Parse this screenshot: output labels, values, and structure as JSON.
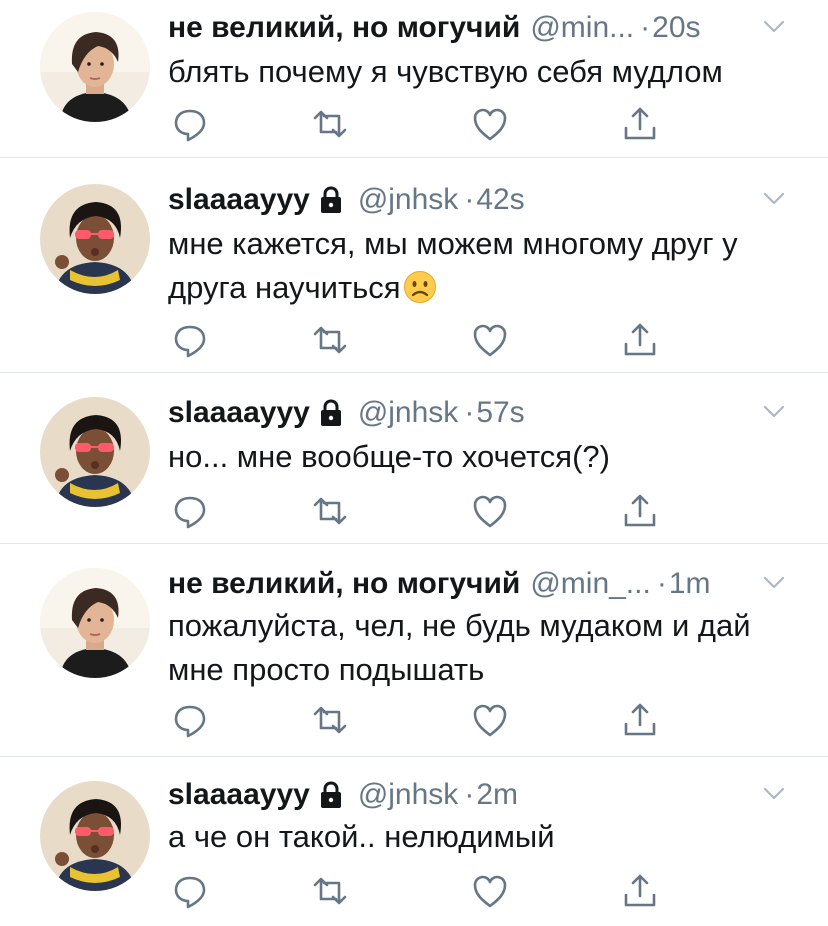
{
  "tweets": [
    {
      "name": "не великий, но могучий",
      "handle": "@min...",
      "separator": "·",
      "time": "20s",
      "locked": false,
      "text": "блять почему я чувствую себя мудлом",
      "avatar": "photo-person-1"
    },
    {
      "name": "slaaaayyy",
      "handle": "@jnhsk",
      "separator": "·",
      "time": "42s",
      "locked": true,
      "text": "мне кажется, мы можем многому друг у друга научиться",
      "emoji": "frowning-face",
      "avatar": "photo-person-2"
    },
    {
      "name": "slaaaayyy",
      "handle": "@jnhsk",
      "separator": "·",
      "time": "57s",
      "locked": true,
      "text": "но... мне вообще-то хочется(?)",
      "avatar": "photo-person-2"
    },
    {
      "name": "не великий, но могучий",
      "handle": "@min_...",
      "separator": "·",
      "time": "1m",
      "locked": false,
      "text": "пожалуйста, чел, не будь мудаком и дай мне просто подышать",
      "avatar": "photo-person-1"
    },
    {
      "name": "slaaaayyy",
      "handle": "@jnhsk",
      "separator": "·",
      "time": "2m",
      "locked": true,
      "text": "а че он такой.. нелюдимый",
      "avatar": "photo-person-2"
    }
  ],
  "actions": [
    "reply-icon",
    "retweet-icon",
    "like-icon",
    "share-icon"
  ],
  "colors": {
    "text": "#14171a",
    "secondary": "#657786",
    "icon": "#657786",
    "divider": "#e1e8ed",
    "background": "#ffffff"
  }
}
